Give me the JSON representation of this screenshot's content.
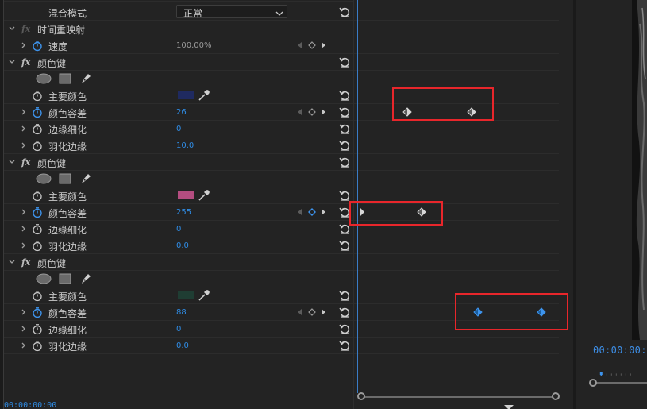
{
  "colors": {
    "accent": "#2f8ce5",
    "highlight_box": "#e8262b",
    "playhead": "#3a7cc6"
  },
  "effects": {
    "blend": {
      "label": "混合模式",
      "value": "正常"
    },
    "time_remap": {
      "title": "时间重映射",
      "speed_label": "速度",
      "speed_value": "100.00%"
    },
    "keys": [
      {
        "title": "颜色键",
        "main_color_label": "主要颜色",
        "main_color": "#1f2a60",
        "tolerance_label": "颜色容差",
        "tolerance_value": "26",
        "edge_thin_label": "边缘细化",
        "edge_thin_value": "0",
        "feather_label": "羽化边缘",
        "feather_value": "10.0"
      },
      {
        "title": "颜色键",
        "main_color_label": "主要颜色",
        "main_color": "#b44d80",
        "tolerance_label": "颜色容差",
        "tolerance_value": "255",
        "edge_thin_label": "边缘细化",
        "edge_thin_value": "0",
        "feather_label": "羽化边缘",
        "feather_value": "0.0"
      },
      {
        "title": "颜色键",
        "main_color_label": "主要颜色",
        "main_color": "#1f3d33",
        "tolerance_label": "颜色容差",
        "tolerance_value": "88",
        "edge_thin_label": "边缘细化",
        "edge_thin_value": "0",
        "feather_label": "羽化边缘",
        "feather_value": "0.0"
      }
    ]
  },
  "monitor": {
    "timecode": "00:00:00:0"
  },
  "bottom": {
    "timecode": "00:00:00:00"
  }
}
